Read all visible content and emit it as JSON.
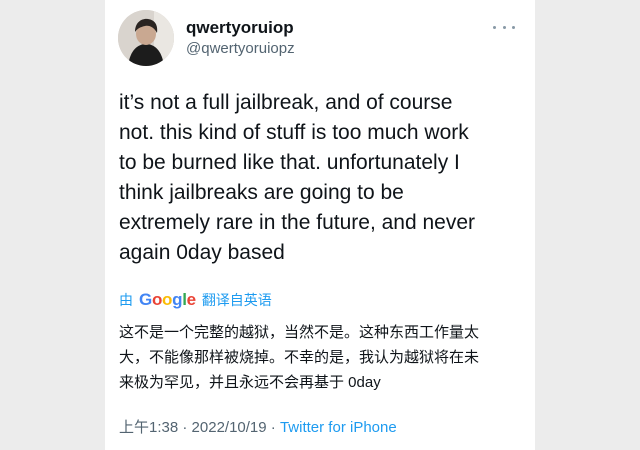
{
  "user": {
    "name": "qwertyoruiop",
    "handle": "@qwertyoruiopz"
  },
  "tweet": {
    "lines": [
      "it’s not a full jailbreak, and of course",
      "not. this kind of stuff is too much work",
      "to be burned like that. unfortunately I",
      "think jailbreaks are going to be",
      "extremely rare in the future, and never",
      "again 0day based"
    ]
  },
  "translation": {
    "prefix": "由",
    "brand_letters": [
      "G",
      "o",
      "o",
      "g",
      "l",
      "e"
    ],
    "suffix": "翻译自英语",
    "lines": [
      "这不是一个完整的越狱，当然不是。这种东西工作量太",
      "大，不能像那样被烧掉。不幸的是，我认为越狱将在未",
      "来极为罕见，并且永远不会再基于 0day"
    ]
  },
  "meta": {
    "time": "上午1:38",
    "separator": " · ",
    "date": "2022/10/19",
    "source": "Twitter for iPhone"
  },
  "icons": {
    "avatar": "profile-photo",
    "more": "more-options-icon"
  },
  "colors": {
    "link": "#1d9bf0",
    "text": "#0f1419",
    "secondary": "#536471",
    "background": "#ececec"
  }
}
